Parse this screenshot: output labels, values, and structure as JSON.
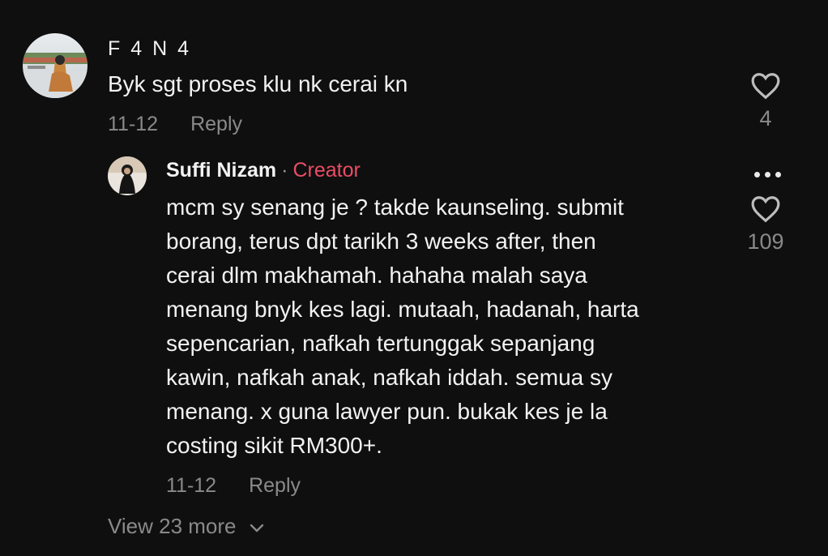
{
  "comment": {
    "username": "F 4 N 4",
    "text": "Byk sgt proses klu nk cerai kn",
    "date": "11-12",
    "reply_label": "Reply",
    "like_count": "4"
  },
  "reply": {
    "username": "Suffi Nizam",
    "separator": "·",
    "badge": "Creator",
    "text_lines": [
      "mcm sy senang je ? takde kaunseling. submit",
      "borang, terus dpt tarikh 3 weeks after, then",
      "cerai dlm makhamah. hahaha malah saya",
      "menang bnyk kes lagi. mutaah, hadanah, harta",
      "sepencarian, nafkah tertunggak sepanjang",
      "kawin, nafkah anak, nafkah iddah. semua sy",
      "menang. x guna lawyer pun. bukak kes je la",
      "costing sikit RM300+."
    ],
    "date": "11-12",
    "reply_label": "Reply",
    "like_count": "109"
  },
  "view_more_label": "View 23 more",
  "colors": {
    "background": "#0f0f0f",
    "creator_badge": "#ea4d65",
    "muted_text": "#8a8a8a"
  },
  "icons": {
    "like": "heart-outline-icon",
    "more": "more-dots-icon",
    "expand": "chevron-down-icon"
  }
}
